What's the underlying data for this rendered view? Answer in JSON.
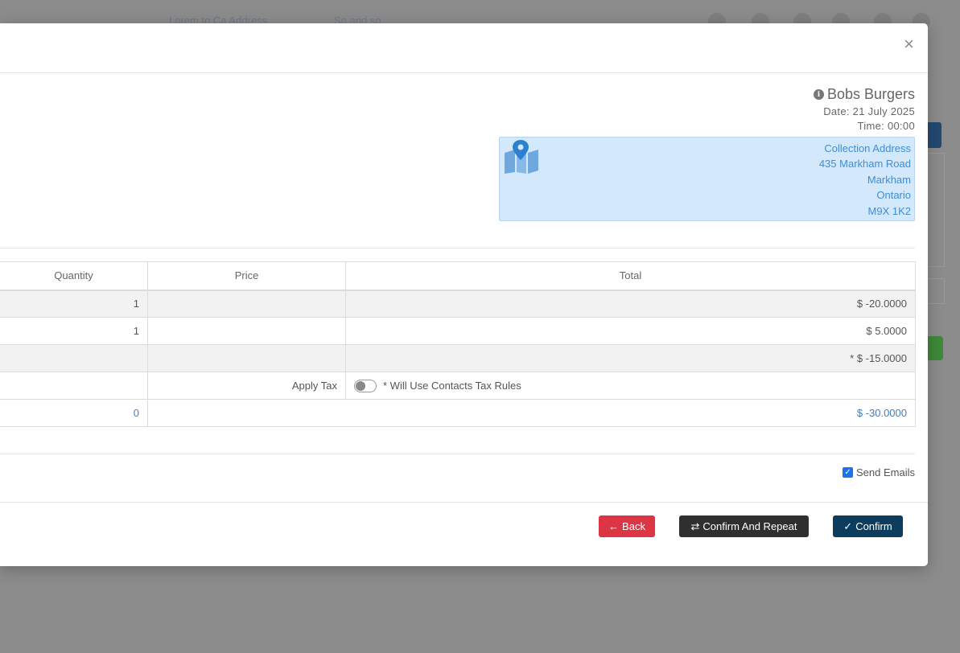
{
  "background": {
    "links": [
      "Lorem to Ca Address",
      "So and so"
    ],
    "accent_blue": "#234a73",
    "accent_green": "#3f8a3a"
  },
  "modal": {
    "close_symbol": "×",
    "company_name": "Bobs Burgers",
    "date": "Date: 21 July 2025",
    "time": "Time: 00:00",
    "address": {
      "label": "Collection Address",
      "street": "435 Markham Road",
      "city": "Markham",
      "province": "Ontario",
      "postal": "M9X 1K2"
    },
    "table": {
      "headers": [
        "Quantity",
        "Price",
        "Total"
      ],
      "rows": [
        {
          "quantity": "1",
          "price": "",
          "total": "$ -20.0000"
        },
        {
          "quantity": "1",
          "price": "",
          "total": "$ 5.0000"
        },
        {
          "quantity": "",
          "price": "",
          "total": "* $ -15.0000"
        }
      ],
      "tax_label": "Apply Tax",
      "tax_note": "* Will Use Contacts Tax Rules",
      "tax_enabled": false,
      "summary_quantity": "0",
      "summary_total": "$ -30.0000"
    },
    "send_emails_label": "Send Emails",
    "send_emails_checked": true,
    "buttons": {
      "back": "Back",
      "confirm_repeat": "Confirm And Repeat",
      "confirm": "Confirm"
    },
    "colors": {
      "back": "#dc3545",
      "confirm_repeat": "#2f2f2f",
      "confirm": "#0d3d5e",
      "address_bg": "#d4e8fb",
      "address_text": "#3d8ed8"
    }
  }
}
